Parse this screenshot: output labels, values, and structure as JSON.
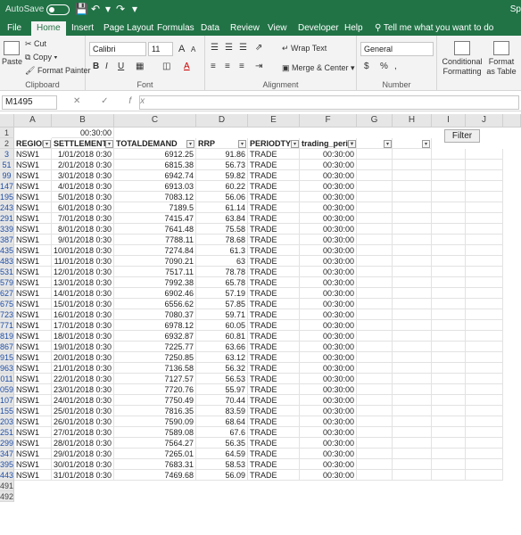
{
  "titlebar": {
    "autosave": "AutoSave",
    "autosave_state": "Off",
    "doc_name": "Sp"
  },
  "tabs": [
    "File",
    "Home",
    "Insert",
    "Page Layout",
    "Formulas",
    "Data",
    "Review",
    "View",
    "Developer",
    "Help"
  ],
  "active_tab": "Home",
  "tellme": "Tell me what you want to do",
  "ribbon": {
    "clipboard": {
      "paste": "Paste",
      "cut": "Cut",
      "copy": "Copy",
      "format_painter": "Format Painter",
      "label": "Clipboard"
    },
    "font": {
      "name": "Calibri",
      "size": "11",
      "bold": "B",
      "italic": "I",
      "underline": "U",
      "grow": "A",
      "shrink": "A",
      "color_letter": "A",
      "label": "Font"
    },
    "alignment": {
      "wrap_text": "Wrap Text",
      "merge_center": "Merge & Center",
      "label": "Alignment"
    },
    "number": {
      "format": "General",
      "currency": "$",
      "percent": "%",
      "comma": ",",
      "label": "Number"
    },
    "styles": {
      "conditional": "Conditional Formatting",
      "format_as_table": "Format as Table"
    }
  },
  "formula_bar": {
    "namebox": "M1495",
    "fx": "fx",
    "cancel": "✕",
    "enter": "✓",
    "content": ""
  },
  "columns": [
    "A",
    "B",
    "C",
    "D",
    "E",
    "F",
    "G",
    "H",
    "I",
    "J"
  ],
  "row1": {
    "number": "1",
    "b1": "00:30:00"
  },
  "header_row": {
    "number": "2",
    "cells": [
      "REGION",
      "SETTLEMENTD",
      "TOTALDEMAND",
      "RRP",
      "PERIODTYP",
      "trading_peri"
    ]
  },
  "filter_button": "Filter",
  "rows": [
    {
      "n": "3",
      "region": "NSW1",
      "date": "1/01/2018 0:30",
      "demand": "6912.25",
      "rrp": "91.86",
      "type": "TRADE",
      "period": "00:30:00"
    },
    {
      "n": "51",
      "region": "NSW1",
      "date": "2/01/2018 0:30",
      "demand": "6815.38",
      "rrp": "56.73",
      "type": "TRADE",
      "period": "00:30:00"
    },
    {
      "n": "99",
      "region": "NSW1",
      "date": "3/01/2018 0:30",
      "demand": "6942.74",
      "rrp": "59.82",
      "type": "TRADE",
      "period": "00:30:00"
    },
    {
      "n": "147",
      "region": "NSW1",
      "date": "4/01/2018 0:30",
      "demand": "6913.03",
      "rrp": "60.22",
      "type": "TRADE",
      "period": "00:30:00"
    },
    {
      "n": "195",
      "region": "NSW1",
      "date": "5/01/2018 0:30",
      "demand": "7083.12",
      "rrp": "56.06",
      "type": "TRADE",
      "period": "00:30:00"
    },
    {
      "n": "243",
      "region": "NSW1",
      "date": "6/01/2018 0:30",
      "demand": "7189.5",
      "rrp": "61.14",
      "type": "TRADE",
      "period": "00:30:00"
    },
    {
      "n": "291",
      "region": "NSW1",
      "date": "7/01/2018 0:30",
      "demand": "7415.47",
      "rrp": "63.84",
      "type": "TRADE",
      "period": "00:30:00"
    },
    {
      "n": "339",
      "region": "NSW1",
      "date": "8/01/2018 0:30",
      "demand": "7641.48",
      "rrp": "75.58",
      "type": "TRADE",
      "period": "00:30:00"
    },
    {
      "n": "387",
      "region": "NSW1",
      "date": "9/01/2018 0:30",
      "demand": "7788.11",
      "rrp": "78.68",
      "type": "TRADE",
      "period": "00:30:00"
    },
    {
      "n": "435",
      "region": "NSW1",
      "date": "10/01/2018 0:30",
      "demand": "7274.84",
      "rrp": "61.3",
      "type": "TRADE",
      "period": "00:30:00"
    },
    {
      "n": "483",
      "region": "NSW1",
      "date": "11/01/2018 0:30",
      "demand": "7090.21",
      "rrp": "63",
      "type": "TRADE",
      "period": "00:30:00"
    },
    {
      "n": "531",
      "region": "NSW1",
      "date": "12/01/2018 0:30",
      "demand": "7517.11",
      "rrp": "78.78",
      "type": "TRADE",
      "period": "00:30:00"
    },
    {
      "n": "579",
      "region": "NSW1",
      "date": "13/01/2018 0:30",
      "demand": "7992.38",
      "rrp": "65.78",
      "type": "TRADE",
      "period": "00:30:00"
    },
    {
      "n": "627",
      "region": "NSW1",
      "date": "14/01/2018 0:30",
      "demand": "6902.46",
      "rrp": "57.19",
      "type": "TRADE",
      "period": "00:30:00"
    },
    {
      "n": "675",
      "region": "NSW1",
      "date": "15/01/2018 0:30",
      "demand": "6556.62",
      "rrp": "57.85",
      "type": "TRADE",
      "period": "00:30:00"
    },
    {
      "n": "723",
      "region": "NSW1",
      "date": "16/01/2018 0:30",
      "demand": "7080.37",
      "rrp": "59.71",
      "type": "TRADE",
      "period": "00:30:00"
    },
    {
      "n": "771",
      "region": "NSW1",
      "date": "17/01/2018 0:30",
      "demand": "6978.12",
      "rrp": "60.05",
      "type": "TRADE",
      "period": "00:30:00"
    },
    {
      "n": "819",
      "region": "NSW1",
      "date": "18/01/2018 0:30",
      "demand": "6932.87",
      "rrp": "60.81",
      "type": "TRADE",
      "period": "00:30:00"
    },
    {
      "n": "867",
      "region": "NSW1",
      "date": "19/01/2018 0:30",
      "demand": "7225.77",
      "rrp": "63.66",
      "type": "TRADE",
      "period": "00:30:00"
    },
    {
      "n": "915",
      "region": "NSW1",
      "date": "20/01/2018 0:30",
      "demand": "7250.85",
      "rrp": "63.12",
      "type": "TRADE",
      "period": "00:30:00"
    },
    {
      "n": "963",
      "region": "NSW1",
      "date": "21/01/2018 0:30",
      "demand": "7136.58",
      "rrp": "56.32",
      "type": "TRADE",
      "period": "00:30:00"
    },
    {
      "n": "011",
      "region": "NSW1",
      "date": "22/01/2018 0:30",
      "demand": "7127.57",
      "rrp": "56.53",
      "type": "TRADE",
      "period": "00:30:00"
    },
    {
      "n": "059",
      "region": "NSW1",
      "date": "23/01/2018 0:30",
      "demand": "7720.76",
      "rrp": "55.97",
      "type": "TRADE",
      "period": "00:30:00"
    },
    {
      "n": "107",
      "region": "NSW1",
      "date": "24/01/2018 0:30",
      "demand": "7750.49",
      "rrp": "70.44",
      "type": "TRADE",
      "period": "00:30:00"
    },
    {
      "n": "155",
      "region": "NSW1",
      "date": "25/01/2018 0:30",
      "demand": "7816.35",
      "rrp": "83.59",
      "type": "TRADE",
      "period": "00:30:00"
    },
    {
      "n": "203",
      "region": "NSW1",
      "date": "26/01/2018 0:30",
      "demand": "7590.09",
      "rrp": "68.64",
      "type": "TRADE",
      "period": "00:30:00"
    },
    {
      "n": "251",
      "region": "NSW1",
      "date": "27/01/2018 0:30",
      "demand": "7589.08",
      "rrp": "67.6",
      "type": "TRADE",
      "period": "00:30:00"
    },
    {
      "n": "299",
      "region": "NSW1",
      "date": "28/01/2018 0:30",
      "demand": "7564.27",
      "rrp": "56.35",
      "type": "TRADE",
      "period": "00:30:00"
    },
    {
      "n": "347",
      "region": "NSW1",
      "date": "29/01/2018 0:30",
      "demand": "7265.01",
      "rrp": "64.59",
      "type": "TRADE",
      "period": "00:30:00"
    },
    {
      "n": "395",
      "region": "NSW1",
      "date": "30/01/2018 0:30",
      "demand": "7683.31",
      "rrp": "58.53",
      "type": "TRADE",
      "period": "00:30:00"
    },
    {
      "n": "443",
      "region": "NSW1",
      "date": "31/01/2018 0:30",
      "demand": "7469.68",
      "rrp": "56.09",
      "type": "TRADE",
      "period": "00:30:00"
    }
  ],
  "trailing_rows": [
    "491",
    "492"
  ]
}
